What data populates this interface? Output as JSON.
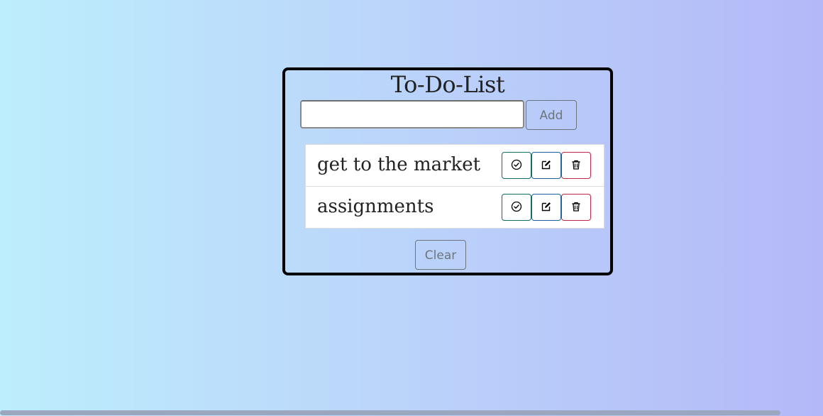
{
  "app": {
    "title": "To-Do-List"
  },
  "input": {
    "value": "",
    "placeholder": ""
  },
  "buttons": {
    "add_label": "Add",
    "clear_label": "Clear"
  },
  "tasks": [
    {
      "text": "get to the market",
      "actions": [
        "check-circle-icon",
        "edit-icon",
        "trash-icon"
      ]
    },
    {
      "text": "assignments",
      "actions": [
        "check-circle-icon",
        "edit-icon",
        "trash-icon"
      ]
    }
  ],
  "colors": {
    "background_start": "#bdeefd",
    "background_end": "#b4b8f8",
    "card_border": "#000000",
    "done_border": "#0f6f6f",
    "edit_border": "#1a5fa0",
    "delete_border": "#c0284a",
    "secondary_button": "#6c757d"
  }
}
